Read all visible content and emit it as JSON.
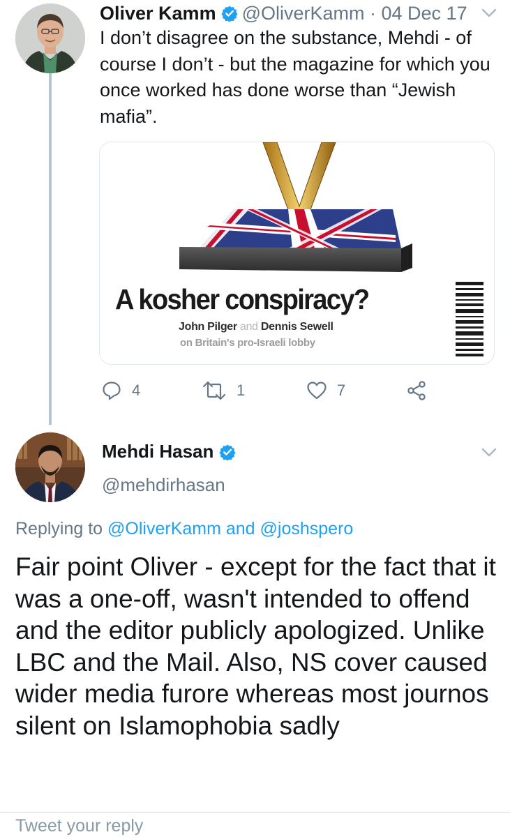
{
  "tweet1": {
    "name": "Oliver Kamm",
    "handle": "@OliverKamm",
    "separator": " · ",
    "date": "04 Dec 17",
    "text": "I don’t disagree on the substance, Mehdi - of course I don’t - but the magazine for which you once worked has done worse than “Jewish mafia”.",
    "media": {
      "headline": "A kosher conspiracy?",
      "byline_a": "John Pilger",
      "byline_and": " and ",
      "byline_b": "Dennis Sewell",
      "subline": "on Britain's pro-Israeli lobby"
    },
    "actions": {
      "reply_count": "4",
      "retweet_count": "1",
      "like_count": "7"
    }
  },
  "tweet2": {
    "name": "Mehdi Hasan",
    "handle": "@mehdirhasan",
    "replying_prefix": "Replying to ",
    "replying_user1": "@OliverKamm",
    "replying_and": " and ",
    "replying_user2": "@joshspero",
    "text": "Fair point Oliver - except for the fact that it was a one-off, wasn't intended to offend and the editor publicly apologized. Unlike LBC and the Mail. Also, NS cover caused wider media furore whereas most journos silent on Islamophobia sadly"
  },
  "reply_box": {
    "placeholder": "Tweet your reply"
  },
  "colors": {
    "accent": "#1da1f2",
    "muted": "#657786",
    "thread_line": "#b5c4d2"
  }
}
